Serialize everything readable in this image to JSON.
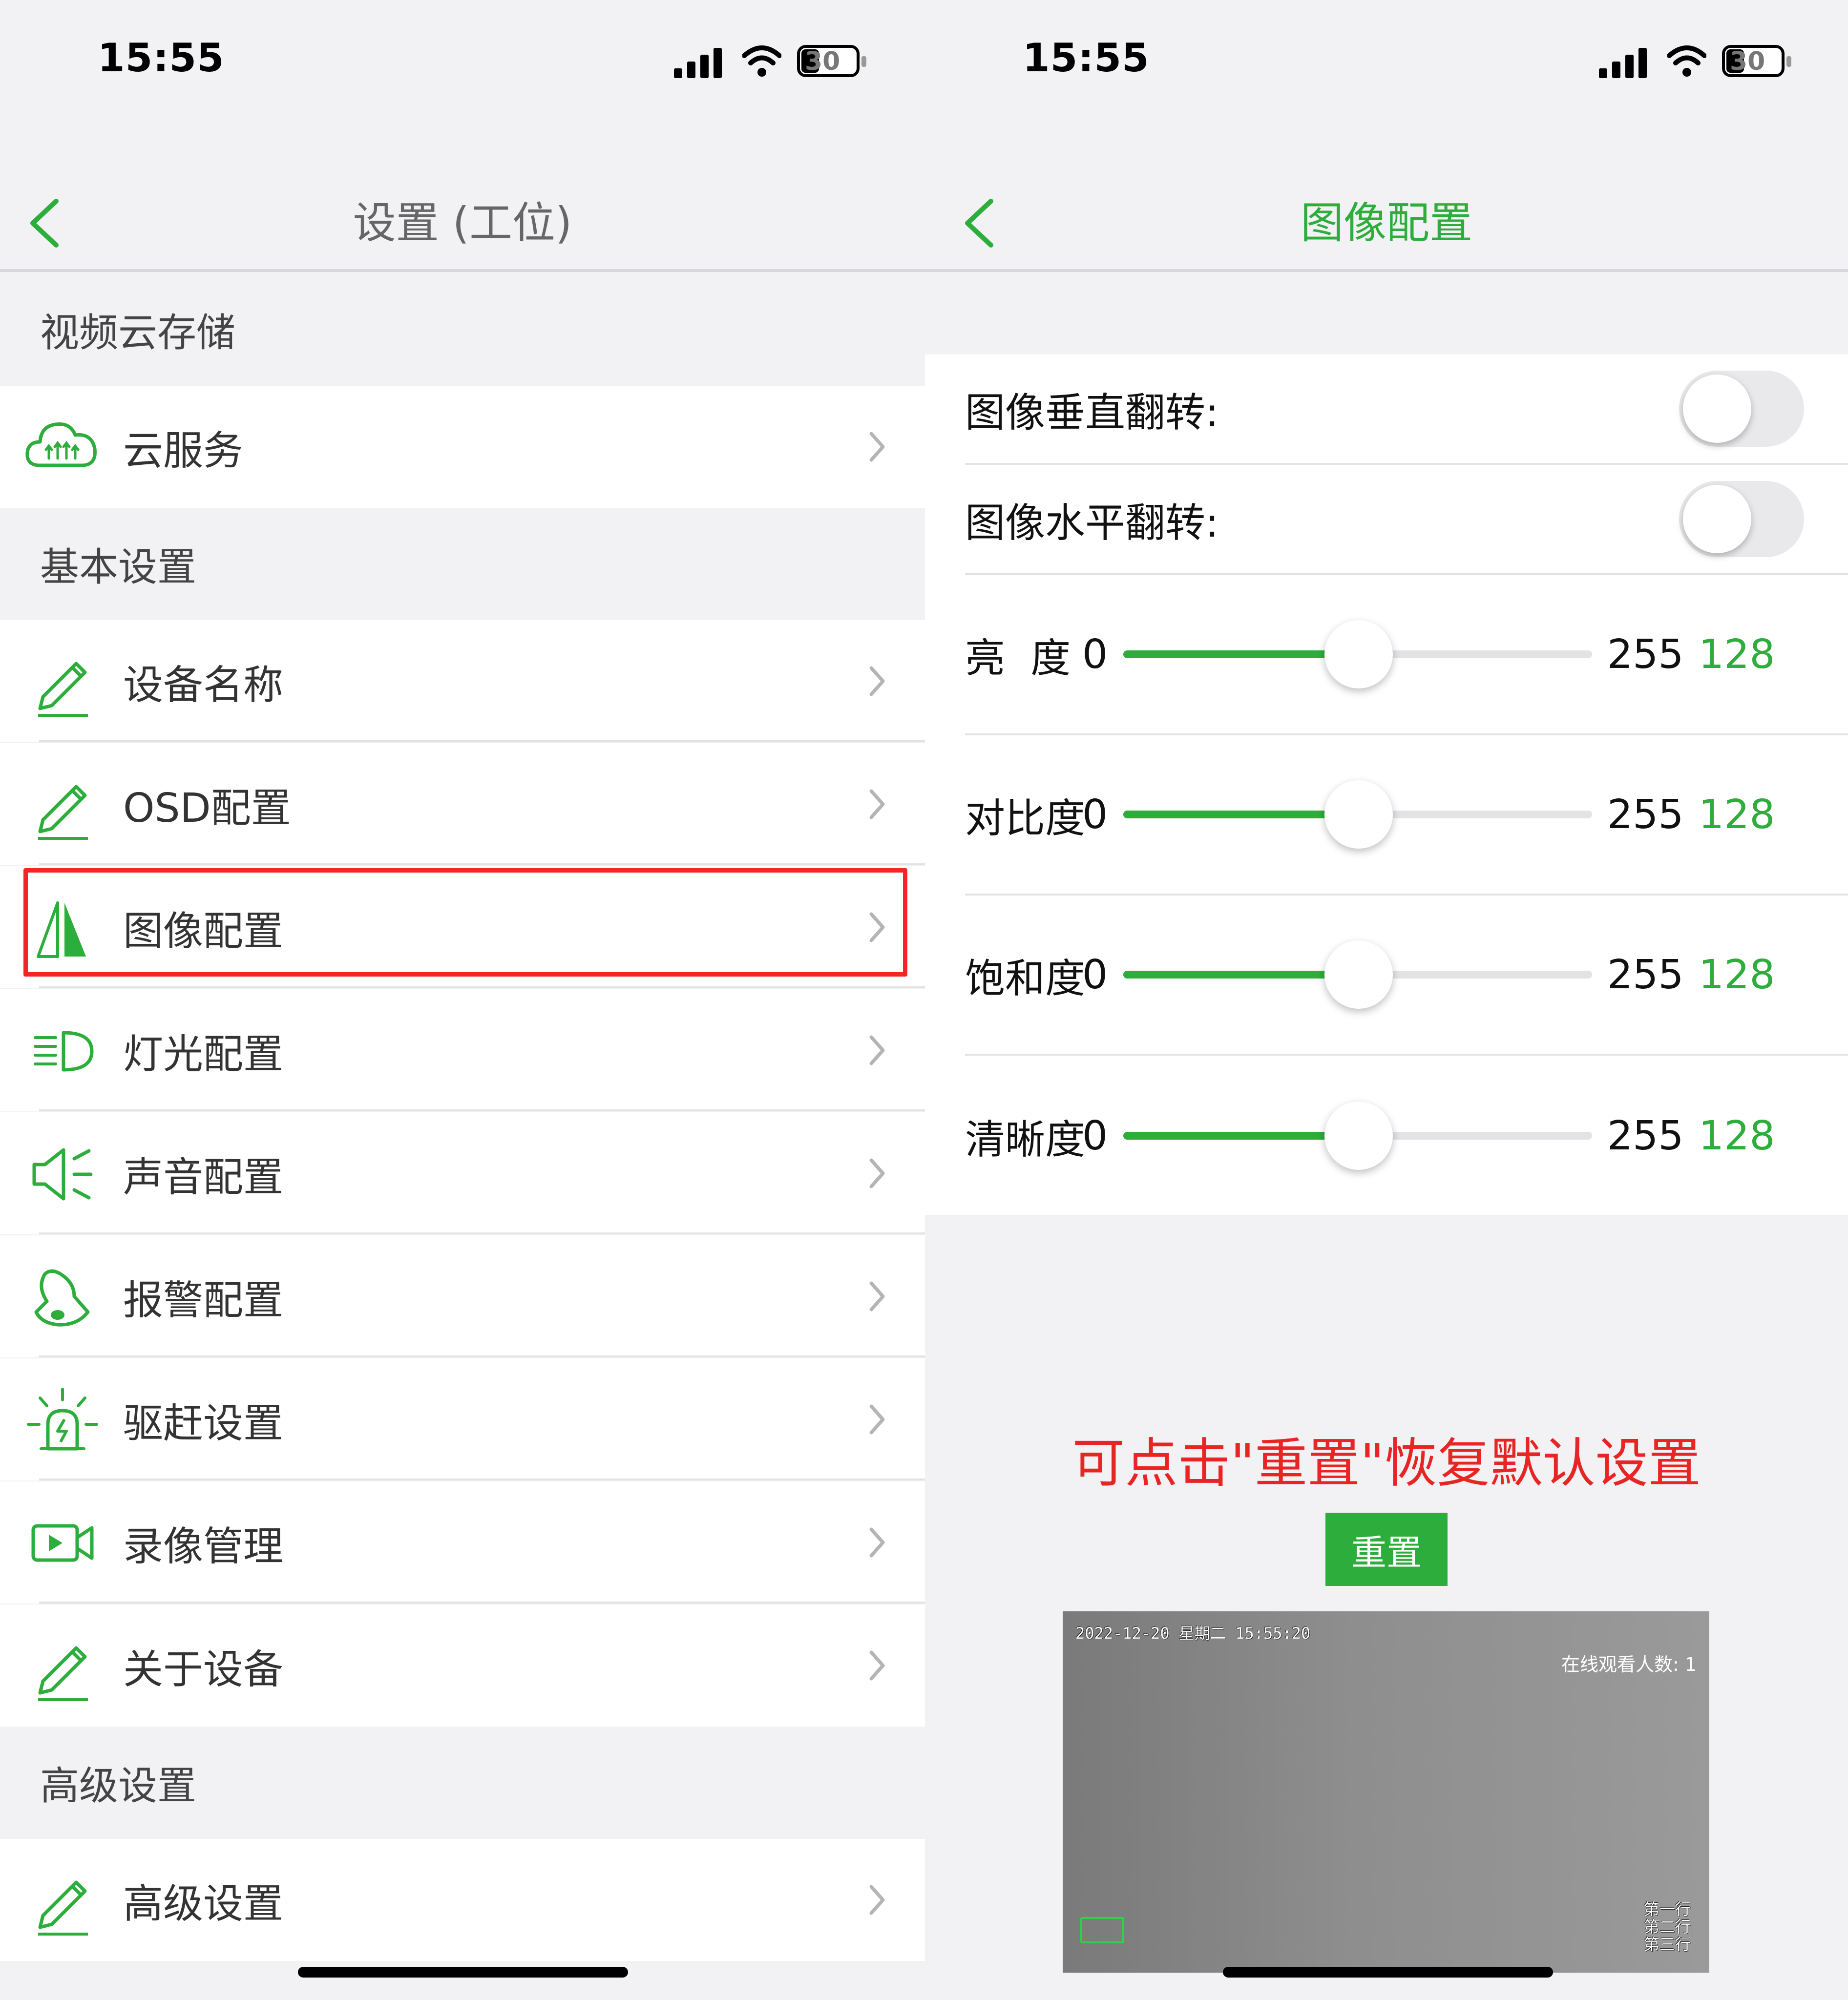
{
  "left": {
    "status": {
      "time": "15:55",
      "battery": "30"
    },
    "nav": {
      "title": "设置 (工位)"
    },
    "sections": [
      {
        "header": "视频云存储",
        "items": [
          {
            "label": "云服务",
            "icon": "cloud-service-icon"
          }
        ]
      },
      {
        "header": "基本设置",
        "items": [
          {
            "label": "设备名称",
            "icon": "pencil-icon"
          },
          {
            "label": "OSD配置",
            "icon": "pencil-icon"
          },
          {
            "label": "图像配置",
            "icon": "image-flip-icon"
          },
          {
            "label": "灯光配置",
            "icon": "headlight-icon"
          },
          {
            "label": "声音配置",
            "icon": "speaker-icon"
          },
          {
            "label": "报警配置",
            "icon": "bell-icon"
          },
          {
            "label": "驱赶设置",
            "icon": "siren-icon"
          },
          {
            "label": "录像管理",
            "icon": "video-camera-icon"
          },
          {
            "label": "关于设备",
            "icon": "pencil-icon"
          }
        ]
      },
      {
        "header": "高级设置",
        "items": [
          {
            "label": "高级设置",
            "icon": "pencil-icon"
          }
        ]
      }
    ]
  },
  "right": {
    "status": {
      "time": "15:55",
      "battery": "30"
    },
    "nav": {
      "title": "图像配置"
    },
    "toggles": [
      {
        "label": "图像垂直翻转:",
        "on": false
      },
      {
        "label": "图像水平翻转:",
        "on": false
      }
    ],
    "sliders": [
      {
        "label": "亮  度",
        "min": "0",
        "max": "255",
        "value": 128
      },
      {
        "label": "对比度",
        "min": "0",
        "max": "255",
        "value": 128
      },
      {
        "label": "饱和度",
        "min": "0",
        "max": "255",
        "value": 128
      },
      {
        "label": "清晰度",
        "min": "0",
        "max": "255",
        "value": 128
      }
    ],
    "hint": "可点击\"重置\"恢复默认设置",
    "reset_label": "重置",
    "preview": {
      "timestamp": "2022-12-20 星期二 15:55:20",
      "viewers": "在线观看人数: 1",
      "corner_lines": [
        "第一行",
        "第二行",
        "第三行"
      ]
    }
  },
  "colors": {
    "accent": "#2dad3b",
    "highlight": "#f52525",
    "hint": "#e82424"
  }
}
